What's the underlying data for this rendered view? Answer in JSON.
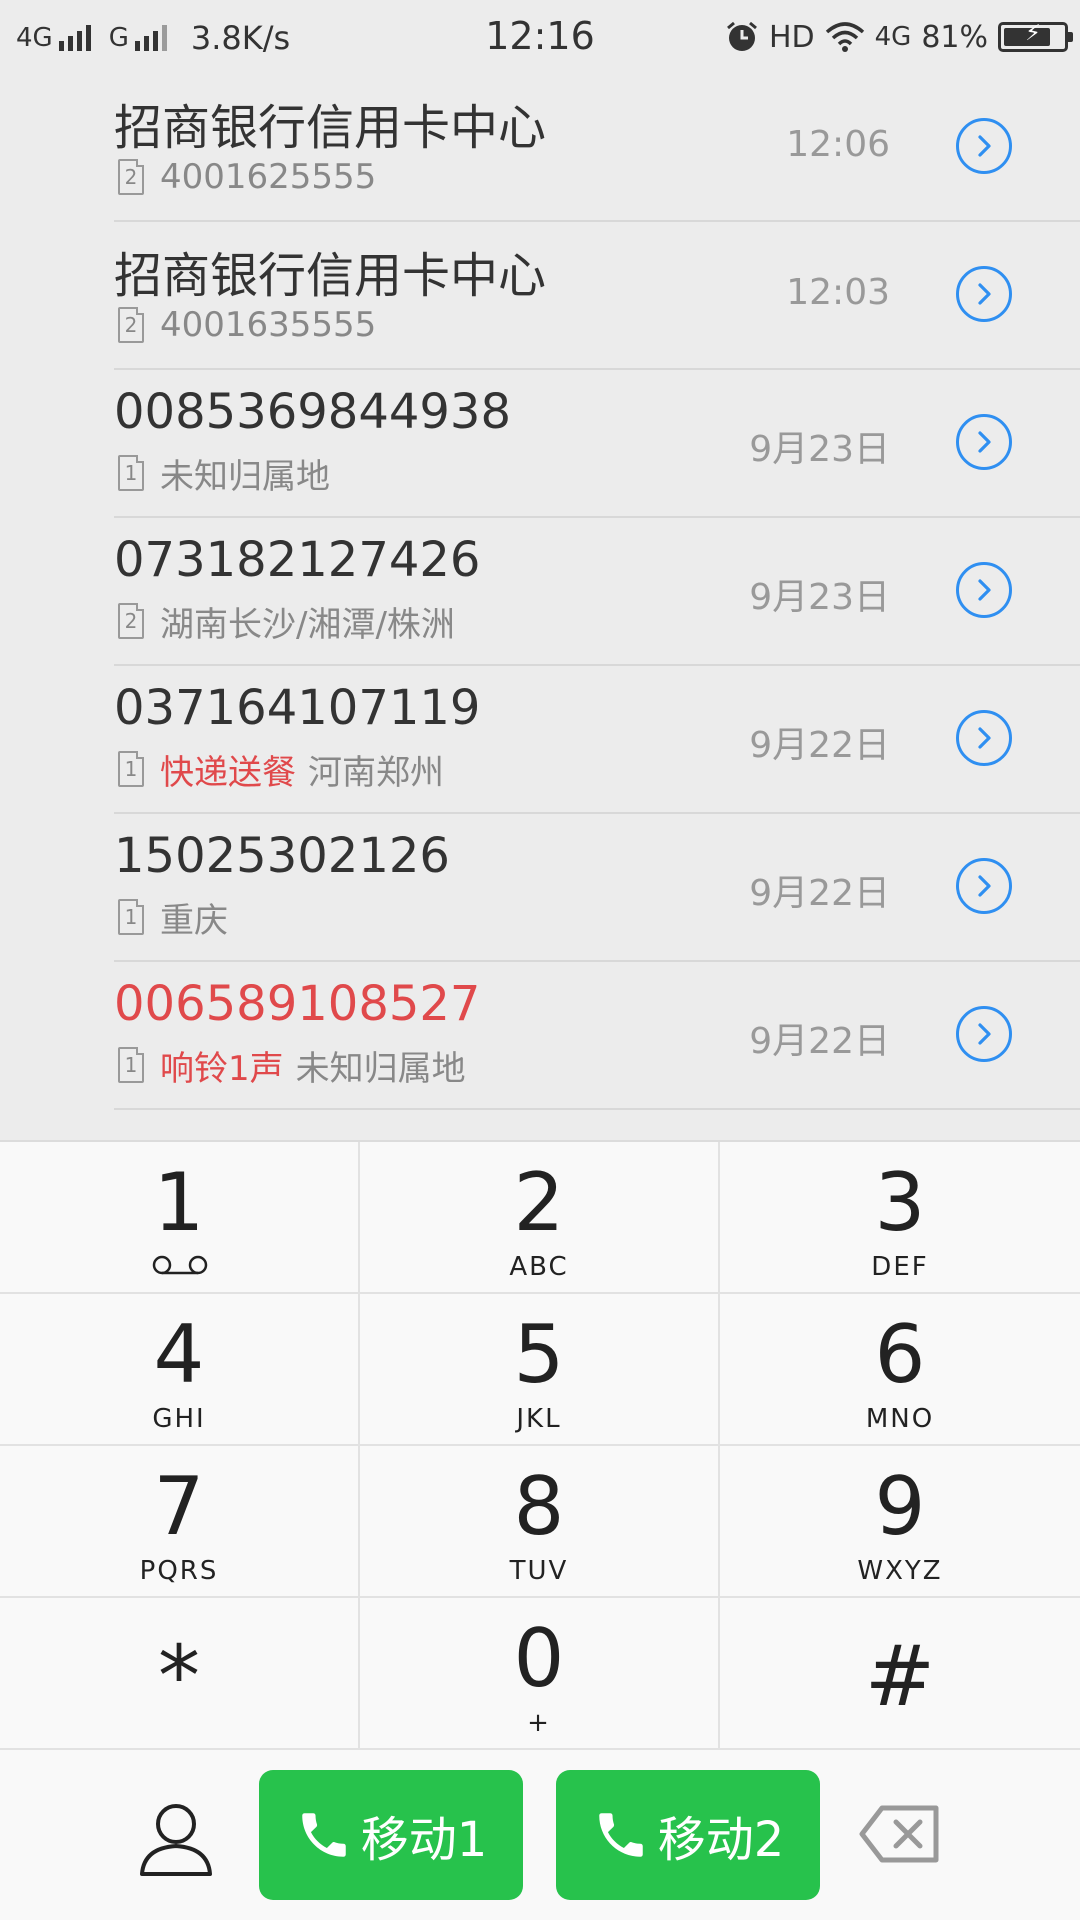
{
  "status_bar": {
    "network1": "4G",
    "network2": "G",
    "speed": "3.8K/s",
    "time": "12:16",
    "hd": "HD",
    "wifi_net": "4G",
    "battery": "81%",
    "battery_level": 0.81
  },
  "calls": [
    {
      "name": "招商银行信用卡中心",
      "sim": "2",
      "tag": "",
      "detail": "4001625555",
      "time": "12:06",
      "missed": false
    },
    {
      "name": "招商银行信用卡中心",
      "sim": "2",
      "tag": "",
      "detail": "4001635555",
      "time": "12:03",
      "missed": false
    },
    {
      "name": "0085369844938",
      "sim": "1",
      "tag": "",
      "detail": "未知归属地",
      "time": "9月23日",
      "missed": false
    },
    {
      "name": "073182127426",
      "sim": "2",
      "tag": "",
      "detail": "湖南长沙/湘潭/株洲",
      "time": "9月23日",
      "missed": false
    },
    {
      "name": "037164107119",
      "sim": "1",
      "tag": "快递送餐",
      "detail": "河南郑州",
      "time": "9月22日",
      "missed": false
    },
    {
      "name": "15025302126",
      "sim": "1",
      "tag": "",
      "detail": "重庆",
      "time": "9月22日",
      "missed": false
    },
    {
      "name": "006589108527",
      "sim": "1",
      "tag": "响铃1声",
      "detail": "未知归属地",
      "time": "9月22日",
      "missed": true
    }
  ],
  "dialpad": {
    "keys": [
      {
        "digit": "1",
        "letters": ""
      },
      {
        "digit": "2",
        "letters": "ABC"
      },
      {
        "digit": "3",
        "letters": "DEF"
      },
      {
        "digit": "4",
        "letters": "GHI"
      },
      {
        "digit": "5",
        "letters": "JKL"
      },
      {
        "digit": "6",
        "letters": "MNO"
      },
      {
        "digit": "7",
        "letters": "PQRS"
      },
      {
        "digit": "8",
        "letters": "TUV"
      },
      {
        "digit": "9",
        "letters": "WXYZ"
      },
      {
        "digit": "*",
        "letters": ""
      },
      {
        "digit": "0",
        "letters": "+"
      },
      {
        "digit": "#",
        "letters": ""
      }
    ]
  },
  "actions": {
    "call1_label": "移动1",
    "call2_label": "移动2"
  },
  "colors": {
    "accent_blue": "#2f8ff1",
    "call_green": "#27c24c",
    "missed_red": "#e0494b"
  },
  "icons": {
    "contacts": "person-outline-icon",
    "phone": "phone-handset-icon",
    "backspace": "backspace-icon",
    "info": "chevron-right-circle-icon",
    "voicemail": "voicemail-icon",
    "alarm": "alarm-clock-icon",
    "wifi": "wifi-icon",
    "battery": "battery-charging-icon"
  }
}
